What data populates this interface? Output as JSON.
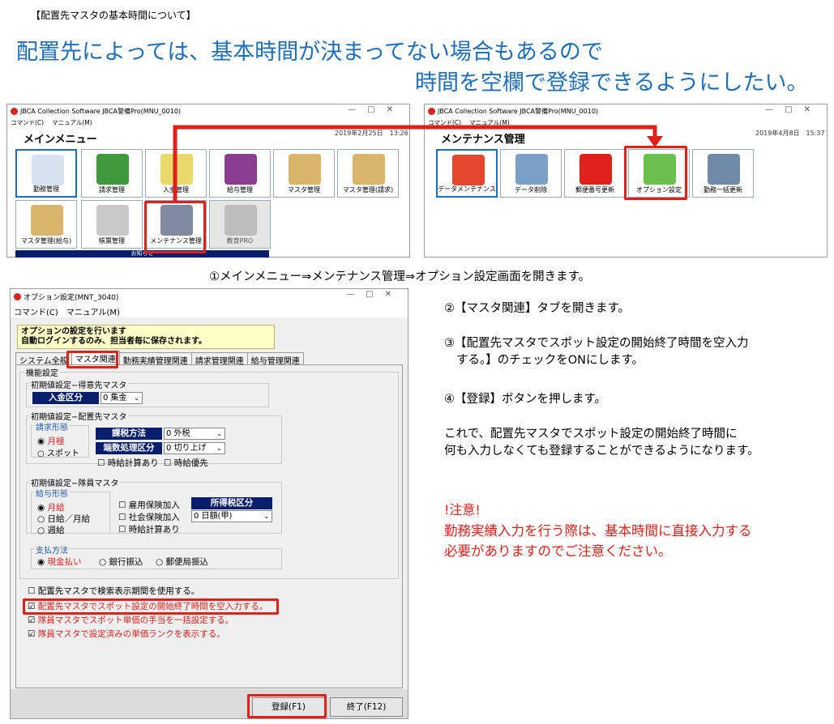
{
  "header": {
    "note": "【配置先マスタの基本時間について】",
    "line1": "配置先によっては、基本時間が決まってない場合もあるので",
    "line2": "時間を空欄で登録できるようにしたい。"
  },
  "main_window": {
    "title": "JBCA Collection Software JBCA警備Pro(MNU_0010)",
    "menu": [
      "コマンド(C)",
      "マニュアル(M)"
    ],
    "heading": "メインメニュー",
    "date": "2019年2月25日　13:26",
    "tiles": [
      {
        "label": "勤務管理"
      },
      {
        "label": "請求管理"
      },
      {
        "label": "入金管理"
      },
      {
        "label": "給与管理"
      },
      {
        "label": "マスタ管理"
      },
      {
        "label": "マスタ管理(請求)"
      },
      {
        "label": "マスタ管理(給与)"
      },
      {
        "label": "帳票管理"
      },
      {
        "label": "メンテナンス管理"
      },
      {
        "label": "教育PRO"
      }
    ],
    "notice": "お知らせ"
  },
  "maint_window": {
    "title": "JBCA Collection Software JBCA警備Pro(MNU_0010)",
    "menu": [
      "コマンド(C)",
      "マニュアル(M)"
    ],
    "heading": "メンテナンス管理",
    "date": "2019年4月8日　15:37",
    "tiles": [
      {
        "label": "データメンテナンス"
      },
      {
        "label": "データ削除"
      },
      {
        "label": "郵便番号更新"
      },
      {
        "label": "オプション設定"
      },
      {
        "label": "勤務一括更新"
      }
    ]
  },
  "step1": "①メインメニュー⇒メンテナンス管理⇒オプション設定画面を開きます。",
  "option_window": {
    "title": "オプション設定(MNT_3040)",
    "menu": [
      "コマンド(C)",
      "マニュアル(M)"
    ],
    "info_line1": "オプションの設定を行います",
    "info_line2": "自動ログインするのみ、担当者毎に保存されます。",
    "tabs": [
      "システム全般",
      "マスタ関連",
      "勤務実績管理関連",
      "請求管理関連",
      "給与管理関連"
    ],
    "group_func": "機能設定",
    "tokui_title": "初期値設定−得意先マスタ",
    "nyukin_label": "入金区分",
    "nyukin_value": "0 集金",
    "haichi_title": "初期値設定−配置先マスタ",
    "seikyu_title": "請求形態",
    "seikyu_opt1": "月極",
    "seikyu_opt2": "スポット",
    "kazei_label": "課税方法",
    "kazei_value": "0 外税",
    "hasu_label": "端数処理区分",
    "hasu_value": "0 切り上げ",
    "chk_jikyu": "時給計算あり",
    "chk_jikyu_yusen": "時給優先",
    "taiin_title": "初期値設定−隊員マスタ",
    "kyuyo_title": "給与形態",
    "kyuyo_opt1": "月給",
    "kyuyo_opt2": "日給／月給",
    "kyuyo_opt3": "週給",
    "chk_koyo": "雇用保険加入",
    "chk_shakai": "社会保険加入",
    "chk_jikyu2": "時給計算あり",
    "shotoku_label": "所得税区分",
    "shotoku_value": "0 日額(甲)",
    "shiharai_title": "支払方法",
    "shiharai_opt1": "現金払い",
    "shiharai_opt2": "銀行振込",
    "shiharai_opt3": "郵便局振込",
    "chk_kensaku": "配置先マスタで検索表示期間を使用する。",
    "chk_spot": "配置先マスタでスポット設定の開始終了時間を空入力する。",
    "chk_teate": "隊員マスタでスポット単価の手当を一括設定する。",
    "chk_rank": "隊員マスタで設定済みの単価ランクを表示する。",
    "btn_register": "登録(F1)",
    "btn_exit": "終了(F12)"
  },
  "steps": {
    "s2": "②【マスタ関連】タブを開きます。",
    "s3a": "③【配置先マスタでスポット設定の開始終了時間を空入力",
    "s3b": "する。】のチェックをONにします。",
    "s4": "④【登録】ボタンを押します。",
    "s5a": "これで、配置先マスタでスポット設定の開始終了時間に",
    "s5b": "何も入力しなくても登録することができるようになります。",
    "warn1": "!注意!",
    "warn2": "勤務実績入力を行う際は、基本時間に直接入力する",
    "warn3": "必要がありますのでご注意ください。"
  },
  "colors": {
    "heading_blue": "#1F6FB8",
    "highlight_red": "#E0201B",
    "navy": "#0A1F6B",
    "info_yellow": "#FFFFC8"
  }
}
